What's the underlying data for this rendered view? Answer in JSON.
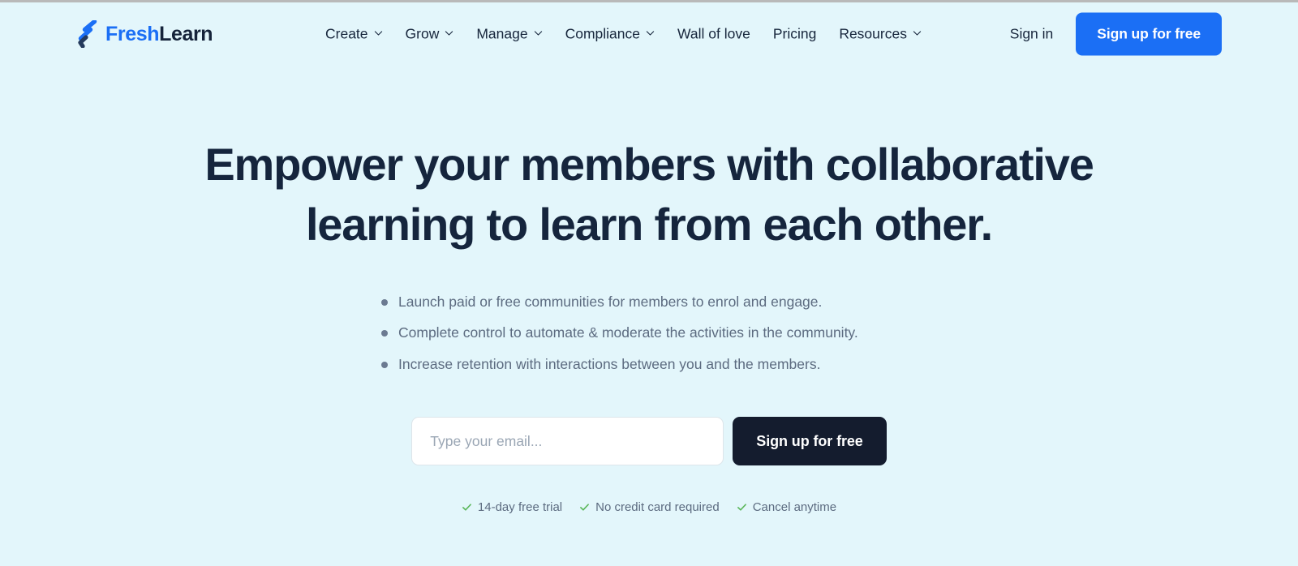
{
  "brand": {
    "logo_icon": "freshlearn-bolt-logo-icon",
    "name_part_1": "Fresh",
    "name_part_2": "Learn",
    "color_primary": "#1b6ff5",
    "color_dark": "#15233a"
  },
  "theme": {
    "background": "#e3f6fb",
    "accent_blue": "#1b6ff5",
    "dark_navy": "#141c2e",
    "heading": "#15253d",
    "body_text": "#5c6b80",
    "check_green": "#5bb75b"
  },
  "nav": {
    "items": [
      {
        "label": "Create",
        "has_dropdown": true
      },
      {
        "label": "Grow",
        "has_dropdown": true
      },
      {
        "label": "Manage",
        "has_dropdown": true
      },
      {
        "label": "Compliance",
        "has_dropdown": true
      },
      {
        "label": "Wall of love",
        "has_dropdown": false
      },
      {
        "label": "Pricing",
        "has_dropdown": false
      },
      {
        "label": "Resources",
        "has_dropdown": true
      }
    ]
  },
  "header_actions": {
    "signin_label": "Sign in",
    "signup_label": "Sign up for free"
  },
  "hero": {
    "title_line_1": "Empower your members with collaborative",
    "title_line_2": "learning to learn from each other.",
    "bullets": [
      "Launch paid or free communities for members to enrol and engage.",
      "Complete control to automate & moderate the activities in the community.",
      "Increase retention with interactions between you and the members."
    ],
    "form": {
      "email_placeholder": "Type your email...",
      "email_value": "",
      "submit_label": "Sign up for free"
    },
    "trust": [
      "14-day free trial",
      "No credit card required",
      "Cancel anytime"
    ]
  }
}
